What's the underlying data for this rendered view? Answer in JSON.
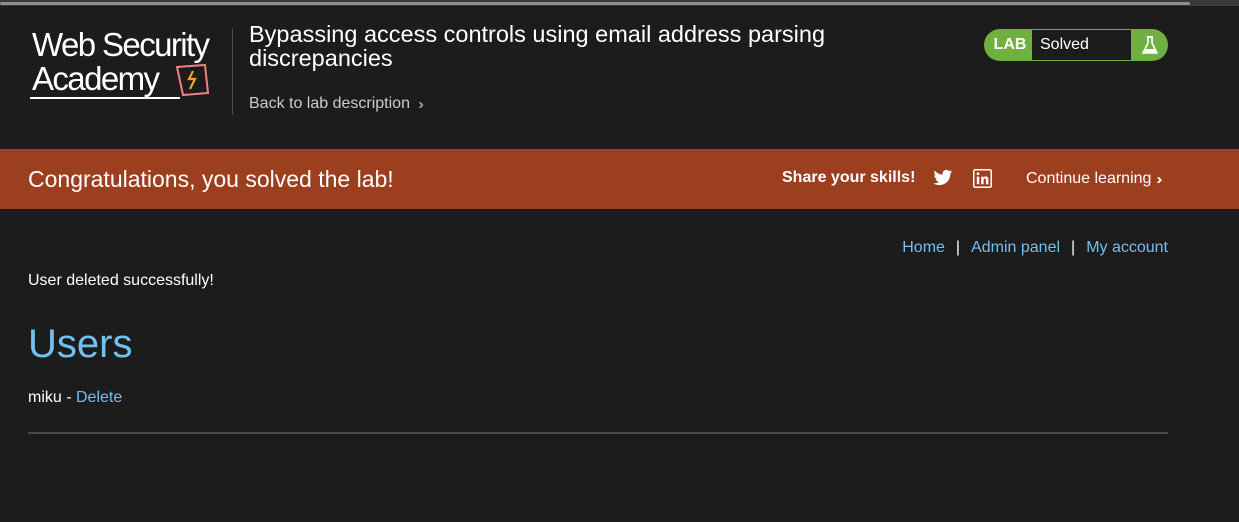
{
  "logo": {
    "line1": "Web Security",
    "line2": "Academy"
  },
  "lab": {
    "title": "Bypassing access controls using email address parsing discrepancies",
    "back_link": "Back to lab description",
    "badge_label": "LAB",
    "status": "Solved"
  },
  "banner": {
    "message": "Congratulations, you solved the lab!",
    "share": "Share your skills!",
    "continue": "Continue learning"
  },
  "nav": {
    "home": "Home",
    "admin": "Admin panel",
    "account": "My account",
    "separator": "|"
  },
  "content": {
    "message": "User deleted successfully!",
    "heading": "Users",
    "users": [
      {
        "name": "miku",
        "separator": " - ",
        "action": "Delete"
      }
    ]
  },
  "colors": {
    "accent": "#70c0f0",
    "banner": "#9c3f1f",
    "badge": "#70b040",
    "background": "#1c1c1c"
  },
  "icons": [
    "flask-icon",
    "twitter-icon",
    "linkedin-icon",
    "chevron-double-right-icon"
  ]
}
